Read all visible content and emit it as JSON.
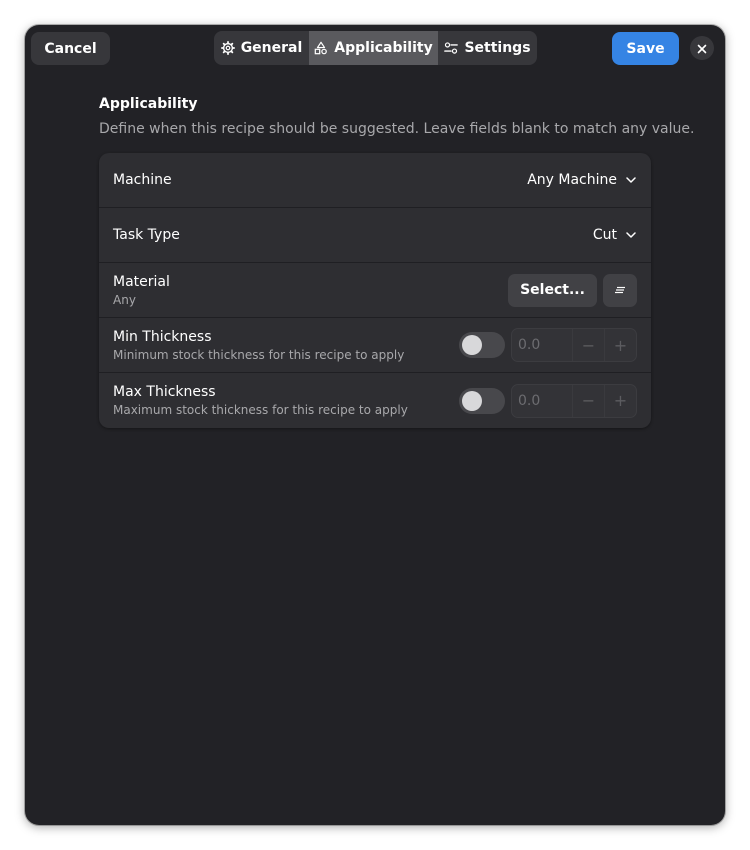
{
  "header": {
    "cancel_label": "Cancel",
    "save_label": "Save",
    "tabs": [
      {
        "label": "General",
        "icon": "gear-icon"
      },
      {
        "label": "Applicability",
        "icon": "shapes-icon",
        "active": true
      },
      {
        "label": "Settings",
        "icon": "sliders-icon"
      }
    ]
  },
  "section": {
    "title": "Applicability",
    "description": "Define when this recipe should be suggested. Leave fields blank to match any value."
  },
  "rows": {
    "machine": {
      "label": "Machine",
      "value": "Any Machine"
    },
    "task_type": {
      "label": "Task Type",
      "value": "Cut"
    },
    "material": {
      "label": "Material",
      "subtitle": "Any",
      "select_label": "Select..."
    },
    "min_thickness": {
      "label": "Min Thickness",
      "subtitle": "Minimum stock thickness for this recipe to apply",
      "value": "0.0",
      "enabled": false
    },
    "max_thickness": {
      "label": "Max Thickness",
      "subtitle": "Maximum stock thickness for this recipe to apply",
      "value": "0.0",
      "enabled": false
    }
  },
  "colors": {
    "accent": "#3584e4",
    "window_bg": "#222226",
    "card_bg": "#2e2e32"
  }
}
